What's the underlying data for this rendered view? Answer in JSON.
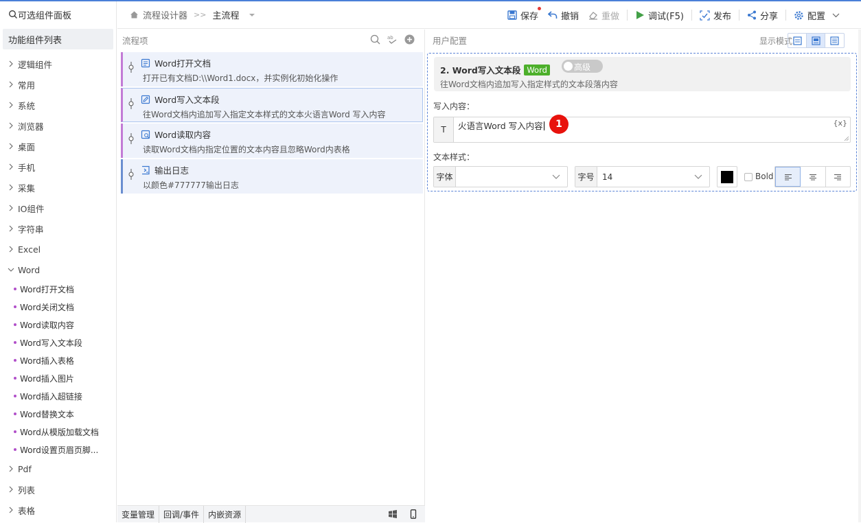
{
  "left_panel": {
    "search_label": "可选组件面板",
    "tab_label": "功能组件列表",
    "categories_top": [
      "逻辑组件",
      "常用",
      "系统",
      "浏览器",
      "桌面",
      "手机",
      "采集",
      "IO组件",
      "字符串",
      "Excel"
    ],
    "expanded_category": "Word",
    "word_items": [
      "Word打开文档",
      "Word关闭文档",
      "Word读取内容",
      "Word写入文本段",
      "Word插入表格",
      "Word插入图片",
      "Word插入超链接",
      "Word替换文本",
      "Word从模版加载文档",
      "Word设置页眉页脚..."
    ],
    "categories_bottom": [
      "Pdf",
      "列表",
      "表格"
    ]
  },
  "toolbar": {
    "breadcrumb_root": "流程设计器",
    "breadcrumb_current": "主流程",
    "save_label": "保存",
    "undo_label": "撤销",
    "redo_label": "重做",
    "debug_label": "调试(F5)",
    "publish_label": "发布",
    "share_label": "分享",
    "config_label": "配置"
  },
  "flow_panel": {
    "header": "流程项",
    "items": [
      {
        "title": "Word打开文档",
        "desc": "打开已有文档D:\\\\Word1.docx，并实例化初始化操作"
      },
      {
        "title": "Word写入文本段",
        "desc": "往Word文档内追加写入指定文本样式的文本火语言Word 写入内容"
      },
      {
        "title": "Word读取内容",
        "desc": "读取Word文档内指定位置的文本内容且忽略Word内表格"
      },
      {
        "title": "输出日志",
        "desc": "以颜色#777777输出日志"
      }
    ],
    "bottom_tabs": [
      "变量管理",
      "回调/事件",
      "内嵌资源"
    ]
  },
  "config_panel": {
    "header": "用户配置",
    "display_mode_label": "显示模式:",
    "card_title": "2. Word写入文本段",
    "card_badge": "Word",
    "toggle_label": "高级",
    "card_desc": "往Word文档内追加写入指定样式的文本段落内容",
    "content_label": "写入内容：",
    "content_prefix": "T",
    "content_value": "火语言Word 写入内容",
    "var_button": "{x}",
    "marker_number": "1",
    "style_label": "文本样式：",
    "font_prefix": "字体",
    "font_value": "",
    "size_prefix": "字号",
    "size_value": "14",
    "color_value": "#000000",
    "bold_label": "Bold"
  }
}
